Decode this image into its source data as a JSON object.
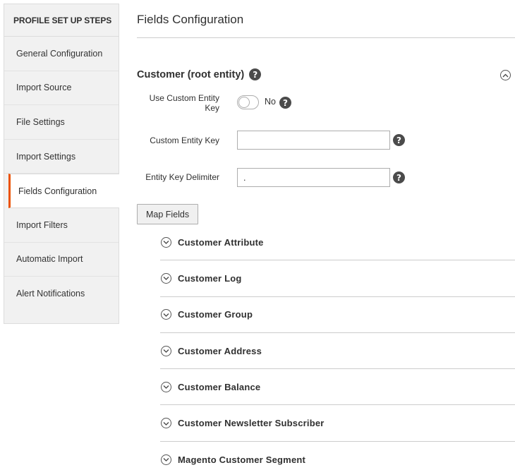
{
  "sidebar": {
    "title": "PROFILE SET UP STEPS",
    "steps": [
      {
        "label": "General Configuration"
      },
      {
        "label": "Import Source"
      },
      {
        "label": "File Settings"
      },
      {
        "label": "Import Settings"
      },
      {
        "label": "Fields Configuration",
        "active": true
      },
      {
        "label": "Import Filters"
      },
      {
        "label": "Automatic Import"
      },
      {
        "label": "Alert Notifications"
      }
    ]
  },
  "main": {
    "page_title": "Fields Configuration",
    "section_title": "Customer (root entity)",
    "help_glyph": "?",
    "use_custom_key": {
      "label_line1": "Use Custom Entity",
      "label_line2": "Key",
      "toggle_text": "No"
    },
    "custom_entity_key": {
      "label": "Custom Entity Key",
      "value": ""
    },
    "entity_key_delimiter": {
      "label": "Entity Key Delimiter",
      "value": "."
    },
    "map_fields_button": "Map Fields",
    "entities": [
      {
        "label": "Customer Attribute"
      },
      {
        "label": "Customer Log"
      },
      {
        "label": "Customer Group"
      },
      {
        "label": "Customer Address"
      },
      {
        "label": "Customer Balance"
      },
      {
        "label": "Customer Newsletter Subscriber"
      },
      {
        "label": "Magento Customer Segment"
      }
    ]
  },
  "colors": {
    "accent": "#eb5202",
    "sidebar_bg": "#f1f1f1",
    "help_icon_bg": "#4b4b4b"
  }
}
